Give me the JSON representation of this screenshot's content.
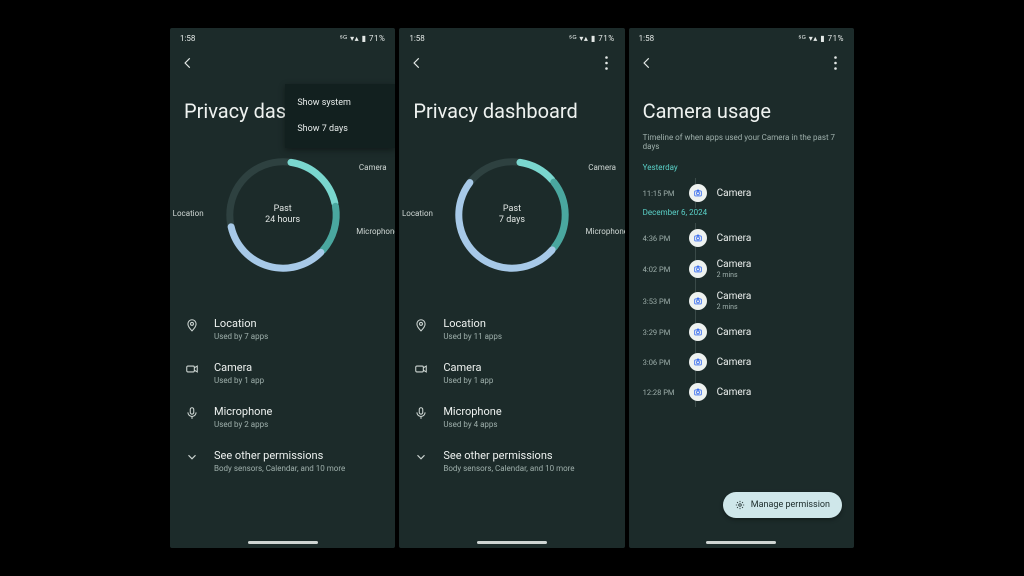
{
  "status": {
    "time": "1:58",
    "right": "⁵ᴳ  ▾▴ ▮ 71%"
  },
  "colors": {
    "camera": "#7ad7cf",
    "microphone": "#4aa79f",
    "location": "#a7c9e8",
    "track": "#2e4140"
  },
  "menu": {
    "show_system": "Show system",
    "show_7_days": "Show 7 days"
  },
  "screen1": {
    "title": "Privacy dashboard",
    "center_l1": "Past",
    "center_l2": "24 hours",
    "labels": {
      "camera": "Camera",
      "microphone": "Microphone",
      "location": "Location"
    },
    "items": [
      {
        "icon": "location",
        "title": "Location",
        "sub": "Used by 7 apps"
      },
      {
        "icon": "camera",
        "title": "Camera",
        "sub": "Used by 1 app"
      },
      {
        "icon": "mic",
        "title": "Microphone",
        "sub": "Used by 2 apps"
      },
      {
        "icon": "chevron",
        "title": "See other permissions",
        "sub": "Body sensors, Calendar, and 10 more"
      }
    ]
  },
  "screen2": {
    "title": "Privacy dashboard",
    "center_l1": "Past",
    "center_l2": "7 days",
    "labels": {
      "camera": "Camera",
      "microphone": "Microphone",
      "location": "Location"
    },
    "items": [
      {
        "icon": "location",
        "title": "Location",
        "sub": "Used by 11 apps"
      },
      {
        "icon": "camera",
        "title": "Camera",
        "sub": "Used by 1 app"
      },
      {
        "icon": "mic",
        "title": "Microphone",
        "sub": "Used by 4 apps"
      },
      {
        "icon": "chevron",
        "title": "See other permissions",
        "sub": "Body sensors, Calendar, and 10 more"
      }
    ]
  },
  "screen3": {
    "title": "Camera usage",
    "desc": "Timeline of when apps used your Camera in the past 7 days",
    "sections": [
      {
        "header": "Yesterday",
        "rows": [
          {
            "time": "11:15 PM",
            "title": "Camera",
            "sub": ""
          }
        ]
      },
      {
        "header": "December 6, 2024",
        "rows": [
          {
            "time": "4:36 PM",
            "title": "Camera",
            "sub": ""
          },
          {
            "time": "4:02 PM",
            "title": "Camera",
            "sub": "2 mins"
          },
          {
            "time": "3:53 PM",
            "title": "Camera",
            "sub": "2 mins"
          },
          {
            "time": "3:29 PM",
            "title": "Camera",
            "sub": ""
          },
          {
            "time": "3:06 PM",
            "title": "Camera",
            "sub": ""
          },
          {
            "time": "12:28 PM",
            "title": "Camera",
            "sub": ""
          }
        ]
      }
    ],
    "fab": "Manage permission"
  },
  "chart_data": [
    {
      "type": "pie",
      "title": "Privacy dashboard — Past 24 hours",
      "categories": [
        "Camera",
        "Microphone",
        "Location"
      ],
      "values": [
        0.2,
        0.15,
        0.35
      ],
      "note": "fractions of ring; remaining 0.30 is empty track"
    },
    {
      "type": "pie",
      "title": "Privacy dashboard — Past 7 days",
      "categories": [
        "Camera",
        "Microphone",
        "Location"
      ],
      "values": [
        0.12,
        0.22,
        0.5
      ],
      "note": "fractions of ring; remaining 0.16 is empty track"
    }
  ]
}
